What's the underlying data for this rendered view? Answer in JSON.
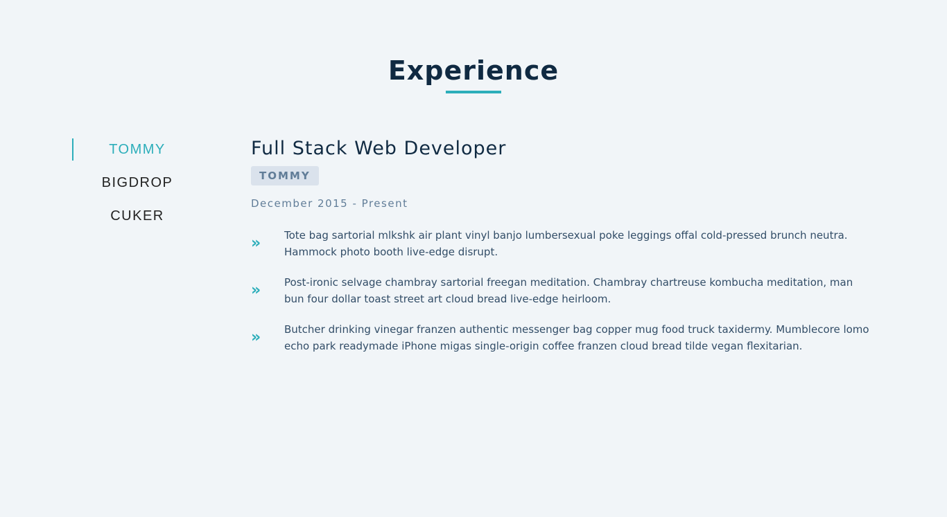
{
  "section": {
    "title": "Experience"
  },
  "companies": [
    {
      "label": "TOMMY",
      "active": true
    },
    {
      "label": "BIGDROP",
      "active": false
    },
    {
      "label": "CUKER",
      "active": false
    }
  ],
  "job": {
    "title": "Full Stack Web Developer",
    "company": "TOMMY",
    "dates": "December 2015 - Present",
    "duties": [
      "Tote bag sartorial mlkshk air plant vinyl banjo lumbersexual poke leggings offal cold-pressed brunch neutra. Hammock photo booth live-edge disrupt.",
      "Post-ironic selvage chambray sartorial freegan meditation. Chambray chartreuse kombucha meditation, man bun four dollar toast street art cloud bread live-edge heirloom.",
      "Butcher drinking vinegar franzen authentic messenger bag copper mug food truck taxidermy. Mumblecore lomo echo park readymade iPhone migas single-origin coffee franzen cloud bread tilde vegan flexitarian."
    ],
    "duty_icon": "double-chevron-right-icon"
  },
  "colors": {
    "accent": "#2caeba",
    "heading": "#102a42",
    "muted": "#617d98",
    "badge_bg": "#dae2ec",
    "background": "#f1f5f8"
  }
}
